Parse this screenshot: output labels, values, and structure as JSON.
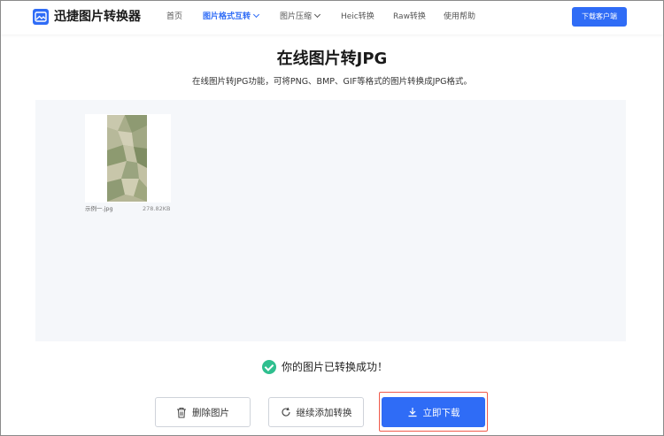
{
  "header": {
    "brand": "迅捷图片转换器",
    "nav": [
      {
        "label": "首页",
        "active": false,
        "dropdown": false
      },
      {
        "label": "图片格式互转",
        "active": true,
        "dropdown": true
      },
      {
        "label": "图片压缩",
        "active": false,
        "dropdown": true
      },
      {
        "label": "Heic转换",
        "active": false,
        "dropdown": false
      },
      {
        "label": "Raw转换",
        "active": false,
        "dropdown": false
      },
      {
        "label": "使用帮助",
        "active": false,
        "dropdown": false
      }
    ],
    "download_client": "下载客户端"
  },
  "main": {
    "title": "在线图片转JPG",
    "subtitle": "在线图片转JPG功能，可将PNG、BMP、GIF等格式的图片转换成JPG格式。"
  },
  "file": {
    "name": "示例一.jpg",
    "size": "278.82KB"
  },
  "status": {
    "message": "你的图片已转换成功！"
  },
  "actions": {
    "delete": "删除图片",
    "continue": "继续添加转换",
    "download": "立即下载"
  },
  "colors": {
    "accent": "#2f6cf6",
    "success": "#2fbf8f",
    "highlight": "#f05a4b"
  }
}
